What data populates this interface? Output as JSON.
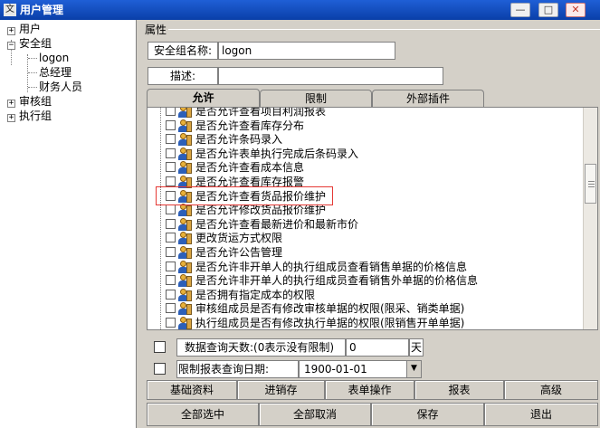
{
  "window": {
    "title": "用户管理",
    "app_icon": "文",
    "minimize_label": "—",
    "maximize_label": "□",
    "close_label": "✕"
  },
  "tree": {
    "nodes": [
      {
        "label": "用户",
        "expander": "+"
      },
      {
        "label": "安全组",
        "expander": "−"
      },
      {
        "label": "logon"
      },
      {
        "label": "总经理"
      },
      {
        "label": "财务人员"
      },
      {
        "label": "审核组",
        "expander": "+"
      },
      {
        "label": "执行组",
        "expander": "+"
      }
    ]
  },
  "properties": {
    "group_title": "属性",
    "name_label": "安全组名称:",
    "name_value": "logon",
    "desc_label": "描述:",
    "desc_value": ""
  },
  "tabs": [
    {
      "label": "允许",
      "active": true
    },
    {
      "label": "限制",
      "active": false
    },
    {
      "label": "外部插件",
      "active": false
    }
  ],
  "permissions": [
    "是否允许查看项目利润报表",
    "是否允许查看库存分布",
    "是否允许条码录入",
    "是否允许表单执行完成后条码录入",
    "是否允许查看成本信息",
    "是否允许查看库存报警",
    "是否允许查看货品报价维护",
    "是否允许修改货品报价维护",
    "是否允许查看最新进价和最新市价",
    "更改货运方式权限",
    "是否允许公告管理",
    "是否允许非开单人的执行组成员查看销售单据的价格信息",
    "是否允许非开单人的执行组成员查看销售外单据的价格信息",
    "是否拥有指定成本的权限",
    "审核组成员是否有修改审核单据的权限(限采、销类单据)",
    "执行组成员是否有修改执行单据的权限(限销售开单单据)"
  ],
  "query_days": {
    "label": "数据查询天数:(0表示没有限制)",
    "value": "0",
    "unit": "天"
  },
  "report_date": {
    "label": "限制报表查询日期:",
    "value": "1900-01-01",
    "arrow": "▼"
  },
  "category_buttons": [
    "基础资料",
    "进销存",
    "表单操作",
    "报表",
    "高级"
  ],
  "action_buttons": [
    "全部选中",
    "全部取消",
    "保存",
    "退出"
  ],
  "colors": {
    "title_bar": "#0a3fa8",
    "highlight_box": "#e53935",
    "face": "#d4d0c8"
  }
}
